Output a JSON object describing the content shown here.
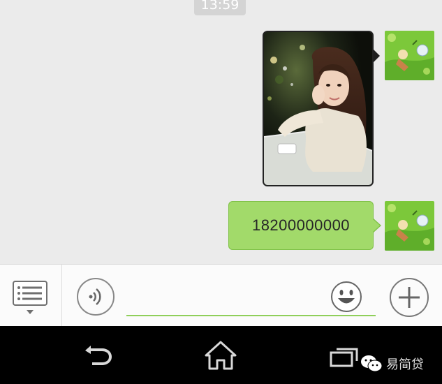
{
  "chat": {
    "timestamp": "13:59",
    "messages": [
      {
        "type": "image",
        "sender": "self",
        "content": "photo of a woman with long wavy hair"
      },
      {
        "type": "text",
        "sender": "self",
        "text": "18200000000"
      }
    ]
  },
  "input_bar": {
    "menu_icon": "list-menu-icon",
    "voice_icon": "voice-icon",
    "emoji_icon": "emoji-icon",
    "plus_icon": "plus-icon",
    "field_value": ""
  },
  "nav": {
    "back_icon": "back-icon",
    "home_icon": "home-icon",
    "recents_icon": "recents-icon"
  },
  "watermark": {
    "text": "易简贷",
    "icon": "wechat-icon"
  },
  "colors": {
    "chat_bg": "#ebebeb",
    "bubble_green": "#a2da6a",
    "accent_green": "#8fcf5a",
    "nav_bg": "#000000"
  }
}
